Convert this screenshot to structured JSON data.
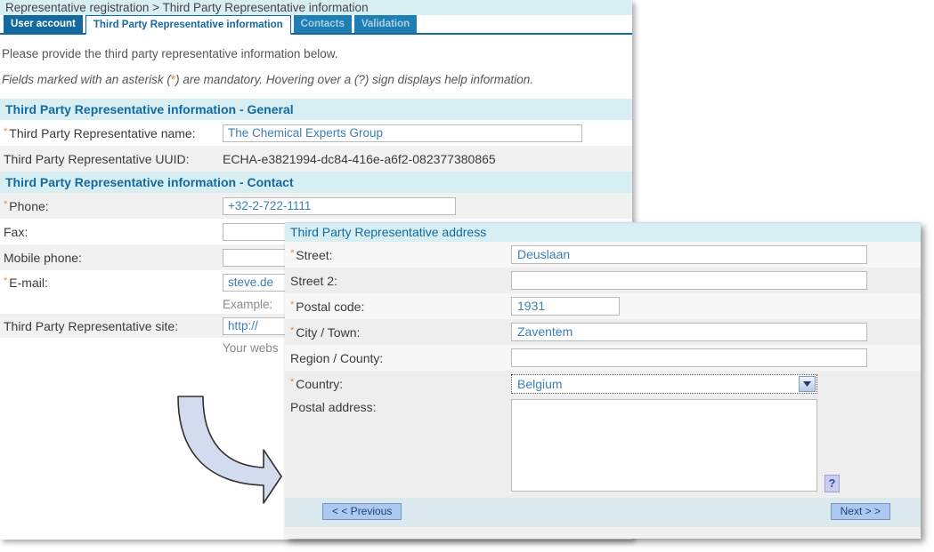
{
  "breadcrumb": "Representative registration > Third Party Representative information",
  "tabs": [
    {
      "label": "User account",
      "state": "dark"
    },
    {
      "label": "Third Party Representative information",
      "state": "active"
    },
    {
      "label": "Contacts",
      "state": "inactive"
    },
    {
      "label": "Validation",
      "state": "inactive"
    }
  ],
  "intro": {
    "line1": "Please provide the third party representative information below.",
    "line2_pre": "Fields marked with an asterisk (",
    "line2_star": "*",
    "line2_post": ") are mandatory. Hovering over a (?) sign displays help information."
  },
  "general": {
    "header": "Third Party Representative information - General",
    "name_label": "Third Party Representative name:",
    "name_value": "The Chemical Experts Group",
    "uuid_label": "Third Party Representative UUID:",
    "uuid_value": "ECHA-e3821994-dc84-416e-a6f2-082377380865"
  },
  "contact": {
    "header": "Third Party Representative information - Contact",
    "phone_label": "Phone:",
    "phone_value": "+32-2-722-1111",
    "fax_label": "Fax:",
    "fax_value": "",
    "mobile_label": "Mobile phone:",
    "mobile_value": "",
    "email_label": "E-mail:",
    "email_value": "steve.de",
    "email_hint": "Example:",
    "site_label": "Third Party Representative site:",
    "site_value": "http://",
    "site_hint": "Your webs"
  },
  "address_dialog": {
    "header": "Third Party Representative address",
    "street_label": "Street:",
    "street_value": "Deuslaan",
    "street2_label": "Street 2:",
    "street2_value": "",
    "postal_code_label": "Postal code:",
    "postal_code_value": "1931",
    "city_label": "City / Town:",
    "city_value": "Zaventem",
    "region_label": "Region / County:",
    "region_value": "",
    "country_label": "Country:",
    "country_value": "Belgium",
    "country_options": [
      "Belgium"
    ],
    "postal_address_label": "Postal address:",
    "postal_address_value": "",
    "help_label": "?",
    "previous_label": "< < Previous",
    "next_label": "Next > >"
  },
  "colors": {
    "accent_blue": "#14699e",
    "header_band": "#d7eef3",
    "field_blue": "#3d7fb5",
    "asterisk_orange": "#e8883a",
    "arrow_fill": "#d3dcee",
    "arrow_stroke": "#303030"
  }
}
